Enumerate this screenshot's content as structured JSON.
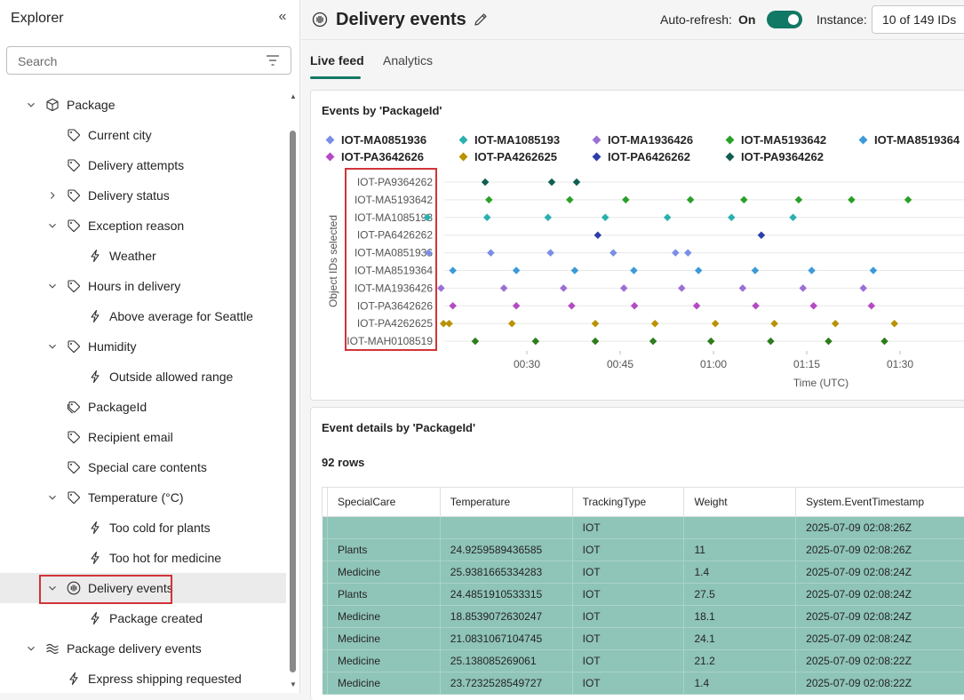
{
  "sidebar": {
    "title": "Explorer",
    "search_placeholder": "Search",
    "items": [
      {
        "label": "Package",
        "indent": 0,
        "chevron": "down",
        "icon": "cube-icon",
        "name": "tree-item-package"
      },
      {
        "label": "Current city",
        "indent": 1,
        "chevron": "none",
        "icon": "tag-icon",
        "name": "tree-item-current-city"
      },
      {
        "label": "Delivery attempts",
        "indent": 1,
        "chevron": "none",
        "icon": "tag-icon",
        "name": "tree-item-delivery-attempts"
      },
      {
        "label": "Delivery status",
        "indent": 1,
        "chevron": "right",
        "icon": "tag-icon",
        "name": "tree-item-delivery-status"
      },
      {
        "label": "Exception reason",
        "indent": 1,
        "chevron": "down",
        "icon": "tag-icon",
        "name": "tree-item-exception-reason"
      },
      {
        "label": "Weather",
        "indent": 2,
        "chevron": "none",
        "icon": "lightning-icon",
        "name": "tree-item-weather"
      },
      {
        "label": "Hours in delivery",
        "indent": 1,
        "chevron": "down",
        "icon": "tag-icon",
        "name": "tree-item-hours-in-delivery"
      },
      {
        "label": "Above average for Seattle",
        "indent": 2,
        "chevron": "none",
        "icon": "lightning-icon",
        "name": "tree-item-above-average-for-seattle"
      },
      {
        "label": "Humidity",
        "indent": 1,
        "chevron": "down",
        "icon": "tag-icon",
        "name": "tree-item-humidity"
      },
      {
        "label": "Outside allowed range",
        "indent": 2,
        "chevron": "none",
        "icon": "lightning-icon",
        "name": "tree-item-outside-allowed-range"
      },
      {
        "label": "PackageId",
        "indent": 1,
        "chevron": "none",
        "icon": "tag-stack-icon",
        "name": "tree-item-packageid"
      },
      {
        "label": "Recipient email",
        "indent": 1,
        "chevron": "none",
        "icon": "tag-icon",
        "name": "tree-item-recipient-email"
      },
      {
        "label": "Special care contents",
        "indent": 1,
        "chevron": "none",
        "icon": "tag-icon",
        "name": "tree-item-special-care-contents"
      },
      {
        "label": "Temperature (°C)",
        "indent": 1,
        "chevron": "down",
        "icon": "tag-icon",
        "name": "tree-item-temperature"
      },
      {
        "label": "Too cold for plants",
        "indent": 2,
        "chevron": "none",
        "icon": "lightning-icon",
        "name": "tree-item-too-cold-for-plants"
      },
      {
        "label": "Too hot for medicine",
        "indent": 2,
        "chevron": "none",
        "icon": "lightning-icon",
        "name": "tree-item-too-hot-for-medicine"
      },
      {
        "label": "Delivery events",
        "indent": 1,
        "chevron": "down",
        "icon": "event-stream-icon",
        "name": "tree-item-delivery-events",
        "selected": true
      },
      {
        "label": "Package created",
        "indent": 2,
        "chevron": "none",
        "icon": "lightning-icon",
        "name": "tree-item-package-created"
      },
      {
        "label": "Package delivery events",
        "indent": 0,
        "chevron": "down",
        "icon": "stream-icon",
        "name": "tree-item-package-delivery-events"
      },
      {
        "label": "Express shipping requested",
        "indent": 1,
        "chevron": "none",
        "icon": "lightning-icon",
        "name": "tree-item-express-shipping-requested"
      }
    ]
  },
  "header": {
    "title": "Delivery events",
    "auto_refresh_label": "Auto-refresh:",
    "auto_refresh_state": "On",
    "instance_label": "Instance:",
    "instance_value": "10 of 149 IDs"
  },
  "tabs": [
    {
      "label": "Live feed",
      "active": true
    },
    {
      "label": "Analytics",
      "active": false
    }
  ],
  "colors": {
    "accent": "#117865",
    "highlight": "#d13438",
    "table_row": "#8fc4b8"
  },
  "chart_data": {
    "type": "scatter",
    "title": "Events by 'PackageId'",
    "ylabel": "Object IDs selected",
    "xlabel": "Time (UTC)",
    "x_ticks": [
      "00:30",
      "00:45",
      "01:00",
      "01:15",
      "01:30"
    ],
    "x_tick_minutes": [
      30,
      45,
      60,
      75,
      90
    ],
    "x_range_minutes": [
      30,
      90
    ],
    "grid": true,
    "legend_position": "top",
    "legend": [
      {
        "name": "IOT-MA0851936",
        "color": "#7b8ee6"
      },
      {
        "name": "IOT-MA1085193",
        "color": "#2ab0b0"
      },
      {
        "name": "IOT-MA1936426",
        "color": "#9b6fd6"
      },
      {
        "name": "IOT-MA5193642",
        "color": "#2aa02a"
      },
      {
        "name": "IOT-MA8519364",
        "color": "#3d9ad9"
      },
      {
        "name": "IOT-PA3642626",
        "color": "#b44bc4"
      },
      {
        "name": "IOT-PA4262625",
        "color": "#b89200"
      },
      {
        "name": "IOT-PA6426262",
        "color": "#2c3fa8"
      },
      {
        "name": "IOT-PA9364262",
        "color": "#0f5e52"
      }
    ],
    "categories": [
      "IOT-PA9364262",
      "IOT-MA5193642",
      "IOT-MA1085193",
      "IOT-PA6426262",
      "IOT-MA0851936",
      "IOT-MA8519364",
      "IOT-MA1936426",
      "IOT-PA3642626",
      "IOT-PA4262625",
      "IOT-MAH0108519"
    ],
    "series": [
      {
        "category": "IOT-PA9364262",
        "color": "#0f5e52",
        "x": [
          23.3,
          34.0,
          38.0
        ]
      },
      {
        "category": "IOT-MA5193642",
        "color": "#2aa02a",
        "x": [
          23.9,
          36.9,
          45.9,
          56.3,
          64.9,
          73.7,
          82.2,
          91.3
        ]
      },
      {
        "category": "IOT-MA1085193",
        "color": "#2ab0b0",
        "x": [
          14.0,
          23.6,
          33.4,
          42.6,
          52.6,
          62.9,
          72.8
        ]
      },
      {
        "category": "IOT-PA6426262",
        "color": "#2c3fa8",
        "x": [
          41.4,
          67.7
        ]
      },
      {
        "category": "IOT-MA0851936",
        "color": "#7b8ee6",
        "x": [
          14.2,
          24.2,
          33.8,
          43.9,
          53.9,
          55.9
        ]
      },
      {
        "category": "IOT-MA8519364",
        "color": "#3d9ad9",
        "x": [
          18.1,
          28.3,
          37.7,
          47.2,
          57.6,
          66.7,
          75.8,
          85.7
        ]
      },
      {
        "category": "IOT-MA1936426",
        "color": "#9b6fd6",
        "x": [
          16.2,
          26.3,
          35.9,
          45.6,
          54.9,
          64.7,
          74.4,
          84.1
        ]
      },
      {
        "category": "IOT-PA3642626",
        "color": "#b44bc4",
        "x": [
          18.1,
          28.3,
          37.2,
          47.3,
          57.3,
          66.8,
          76.1,
          85.4
        ]
      },
      {
        "category": "IOT-PA4262625",
        "color": "#b89200",
        "x": [
          16.6,
          17.5,
          27.6,
          41.0,
          50.6,
          60.3,
          69.8,
          79.6,
          89.1
        ]
      },
      {
        "category": "IOT-MAH0108519",
        "color": "#2e7d1c",
        "x": [
          21.7,
          31.4,
          41.0,
          50.3,
          59.6,
          69.2,
          78.5,
          87.5
        ]
      }
    ]
  },
  "table": {
    "title": "Event details by 'PackageId'",
    "rows_count": "92 rows",
    "columns": [
      "SpecialCare",
      "Temperature",
      "TrackingType",
      "Weight",
      "System.EventTimestamp"
    ],
    "rows": [
      [
        "",
        "",
        "IOT",
        "",
        "2025-07-09 02:08:26Z"
      ],
      [
        "Plants",
        "24.9259589436585",
        "IOT",
        "11",
        "2025-07-09 02:08:26Z"
      ],
      [
        "Medicine",
        "25.9381665334283",
        "IOT",
        "1.4",
        "2025-07-09 02:08:24Z"
      ],
      [
        "Plants",
        "24.4851910533315",
        "IOT",
        "27.5",
        "2025-07-09 02:08:24Z"
      ],
      [
        "Medicine",
        "18.8539072630247",
        "IOT",
        "18.1",
        "2025-07-09 02:08:24Z"
      ],
      [
        "Medicine",
        "21.0831067104745",
        "IOT",
        "24.1",
        "2025-07-09 02:08:24Z"
      ],
      [
        "Medicine",
        "25.138085269061",
        "IOT",
        "21.2",
        "2025-07-09 02:08:22Z"
      ],
      [
        "Medicine",
        "23.7232528549727",
        "IOT",
        "1.4",
        "2025-07-09 02:08:22Z"
      ]
    ]
  }
}
